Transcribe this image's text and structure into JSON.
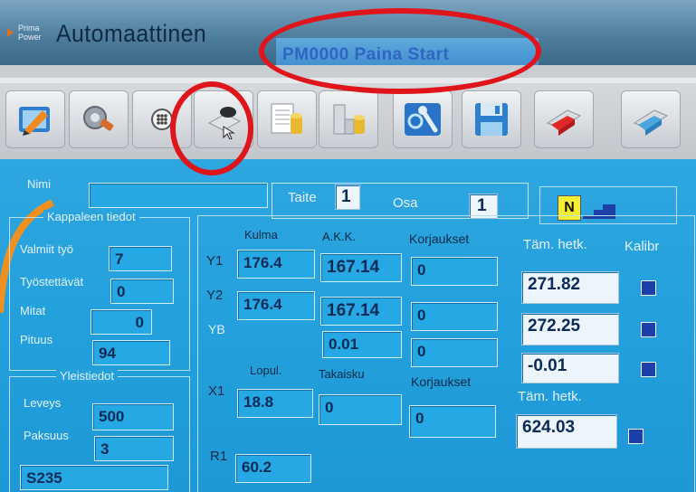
{
  "header": {
    "logo_line1": "Prima",
    "logo_line2": "Power",
    "mode": "Automaattinen",
    "status": "PM0000 Paina Start"
  },
  "toolbar": [
    {
      "name": "edit-icon"
    },
    {
      "name": "tools-icon"
    },
    {
      "name": "grid-icon"
    },
    {
      "name": "bend-program-icon"
    },
    {
      "name": "documents-icon"
    },
    {
      "name": "database-icon"
    },
    {
      "name": "settings-icon"
    },
    {
      "name": "save-icon"
    },
    {
      "name": "bend-red-icon"
    },
    {
      "name": "bend-blue-icon"
    }
  ],
  "top_row": {
    "nimi_label": "Nimi",
    "nimi_value": "",
    "taite_label": "Taite",
    "taite_value": "1",
    "osa_label": "Osa",
    "osa_value": "1",
    "mode_badge": "N"
  },
  "kappale": {
    "title": "Kappaleen tiedot",
    "rows": [
      {
        "label": "Valmiit työ",
        "value": "7"
      },
      {
        "label": "Työstettävät",
        "value": "0"
      },
      {
        "label": "Mitat",
        "value": "0"
      },
      {
        "label": "Pituus",
        "value": "94"
      }
    ]
  },
  "yleis": {
    "title": "Yleistiedot",
    "rows": [
      {
        "label": "Leveys",
        "value": "500"
      },
      {
        "label": "Paksuus",
        "value": "3"
      },
      {
        "label": "",
        "value": "S235"
      }
    ]
  },
  "axes": {
    "headers": {
      "kulma": "Kulma",
      "akk": "A.K.K.",
      "korj": "Korjaukset",
      "tam": "Täm. hetk.",
      "kalibr": "Kalibr"
    },
    "y1": {
      "label": "Y1",
      "kulma": "176.4",
      "akk": "167.14",
      "korj": "0",
      "tam": "271.82"
    },
    "y2": {
      "label": "Y2",
      "kulma": "176.4",
      "akk": "167.14",
      "korj": "0",
      "tam": "272.25"
    },
    "yb": {
      "label": "YB",
      "akk": "0.01",
      "korj": "0",
      "tam": "-0.01"
    },
    "headers2": {
      "lopul": "Lopul.",
      "takaisku": "Takaisku",
      "korj": "Korjaukset",
      "tam": "Täm. hetk."
    },
    "x1": {
      "label": "X1",
      "lopul": "18.8",
      "takaisku": "0",
      "korj": "0",
      "tam": "624.03"
    },
    "r1": {
      "label": "R1",
      "lopul": "60.2"
    }
  }
}
